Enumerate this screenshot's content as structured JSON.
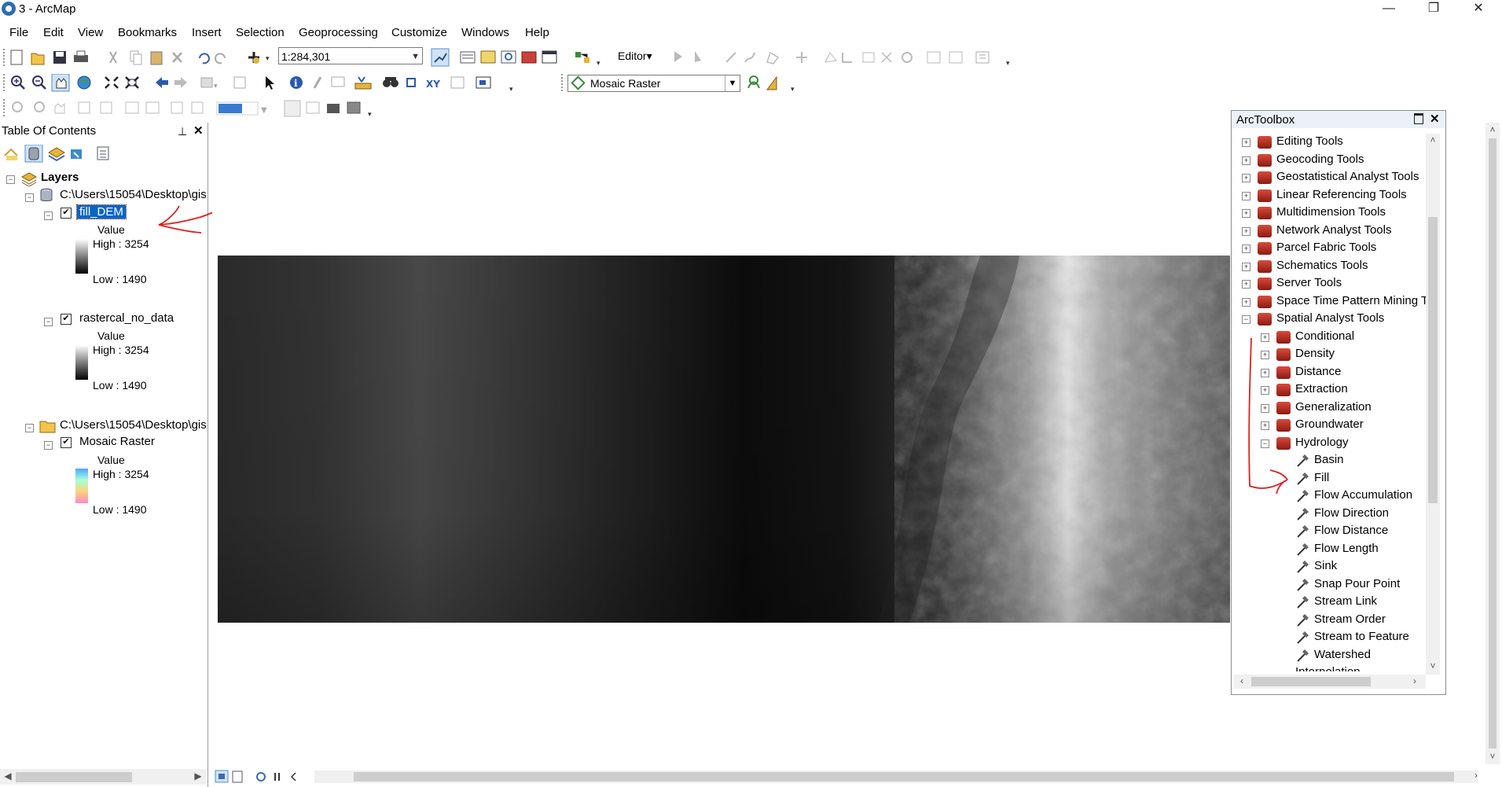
{
  "window": {
    "title": "3 - ArcMap",
    "minimize": "—",
    "restore": "❐",
    "close": "✕"
  },
  "menu": [
    "File",
    "Edit",
    "View",
    "Bookmarks",
    "Insert",
    "Selection",
    "Geoprocessing",
    "Customize",
    "Windows",
    "Help"
  ],
  "toolbar": {
    "scale": "1:284,301",
    "editor_label": "Editor▾",
    "layer_select": "Mosaic Raster"
  },
  "toc": {
    "title": "Table Of Contents",
    "root": "Layers",
    "groups": [
      {
        "path": "C:\\Users\\15054\\Desktop\\gis",
        "layers": [
          {
            "name": "fill_DEM",
            "legend_title": "Value",
            "high": "High : 3254",
            "low": "Low : 1490",
            "selected": true
          },
          {
            "name": "rastercal_no_data",
            "legend_title": "Value",
            "high": "High : 3254",
            "low": "Low : 1490",
            "selected": false
          }
        ]
      },
      {
        "path": "C:\\Users\\15054\\Desktop\\gis",
        "layers": [
          {
            "name": "Mosaic Raster",
            "legend_title": "Value",
            "high": "High : 3254",
            "low": "Low : 1490",
            "selected": false
          }
        ]
      }
    ]
  },
  "toolbox": {
    "title": "ArcToolbox",
    "toolsets": [
      "Editing Tools",
      "Geocoding Tools",
      "Geostatistical Analyst Tools",
      "Linear Referencing Tools",
      "Multidimension Tools",
      "Network Analyst Tools",
      "Parcel Fabric Tools",
      "Schematics Tools",
      "Server Tools",
      "Space Time Pattern Mining T",
      "Spatial Analyst Tools"
    ],
    "spatial_children": [
      "Conditional",
      "Density",
      "Distance",
      "Extraction",
      "Generalization",
      "Groundwater",
      "Hydrology"
    ],
    "hydrology_tools": [
      "Basin",
      "Fill",
      "Flow Accumulation",
      "Flow Direction",
      "Flow Distance",
      "Flow Length",
      "Sink",
      "Snap Pour Point",
      "Stream Link",
      "Stream Order",
      "Stream to Feature",
      "Watershed"
    ],
    "next_item": "Interpolation"
  },
  "colors": {
    "selection": "#0a64c8",
    "annotation": "#e01e1e",
    "toolbox_header": "#ebf1f8"
  }
}
